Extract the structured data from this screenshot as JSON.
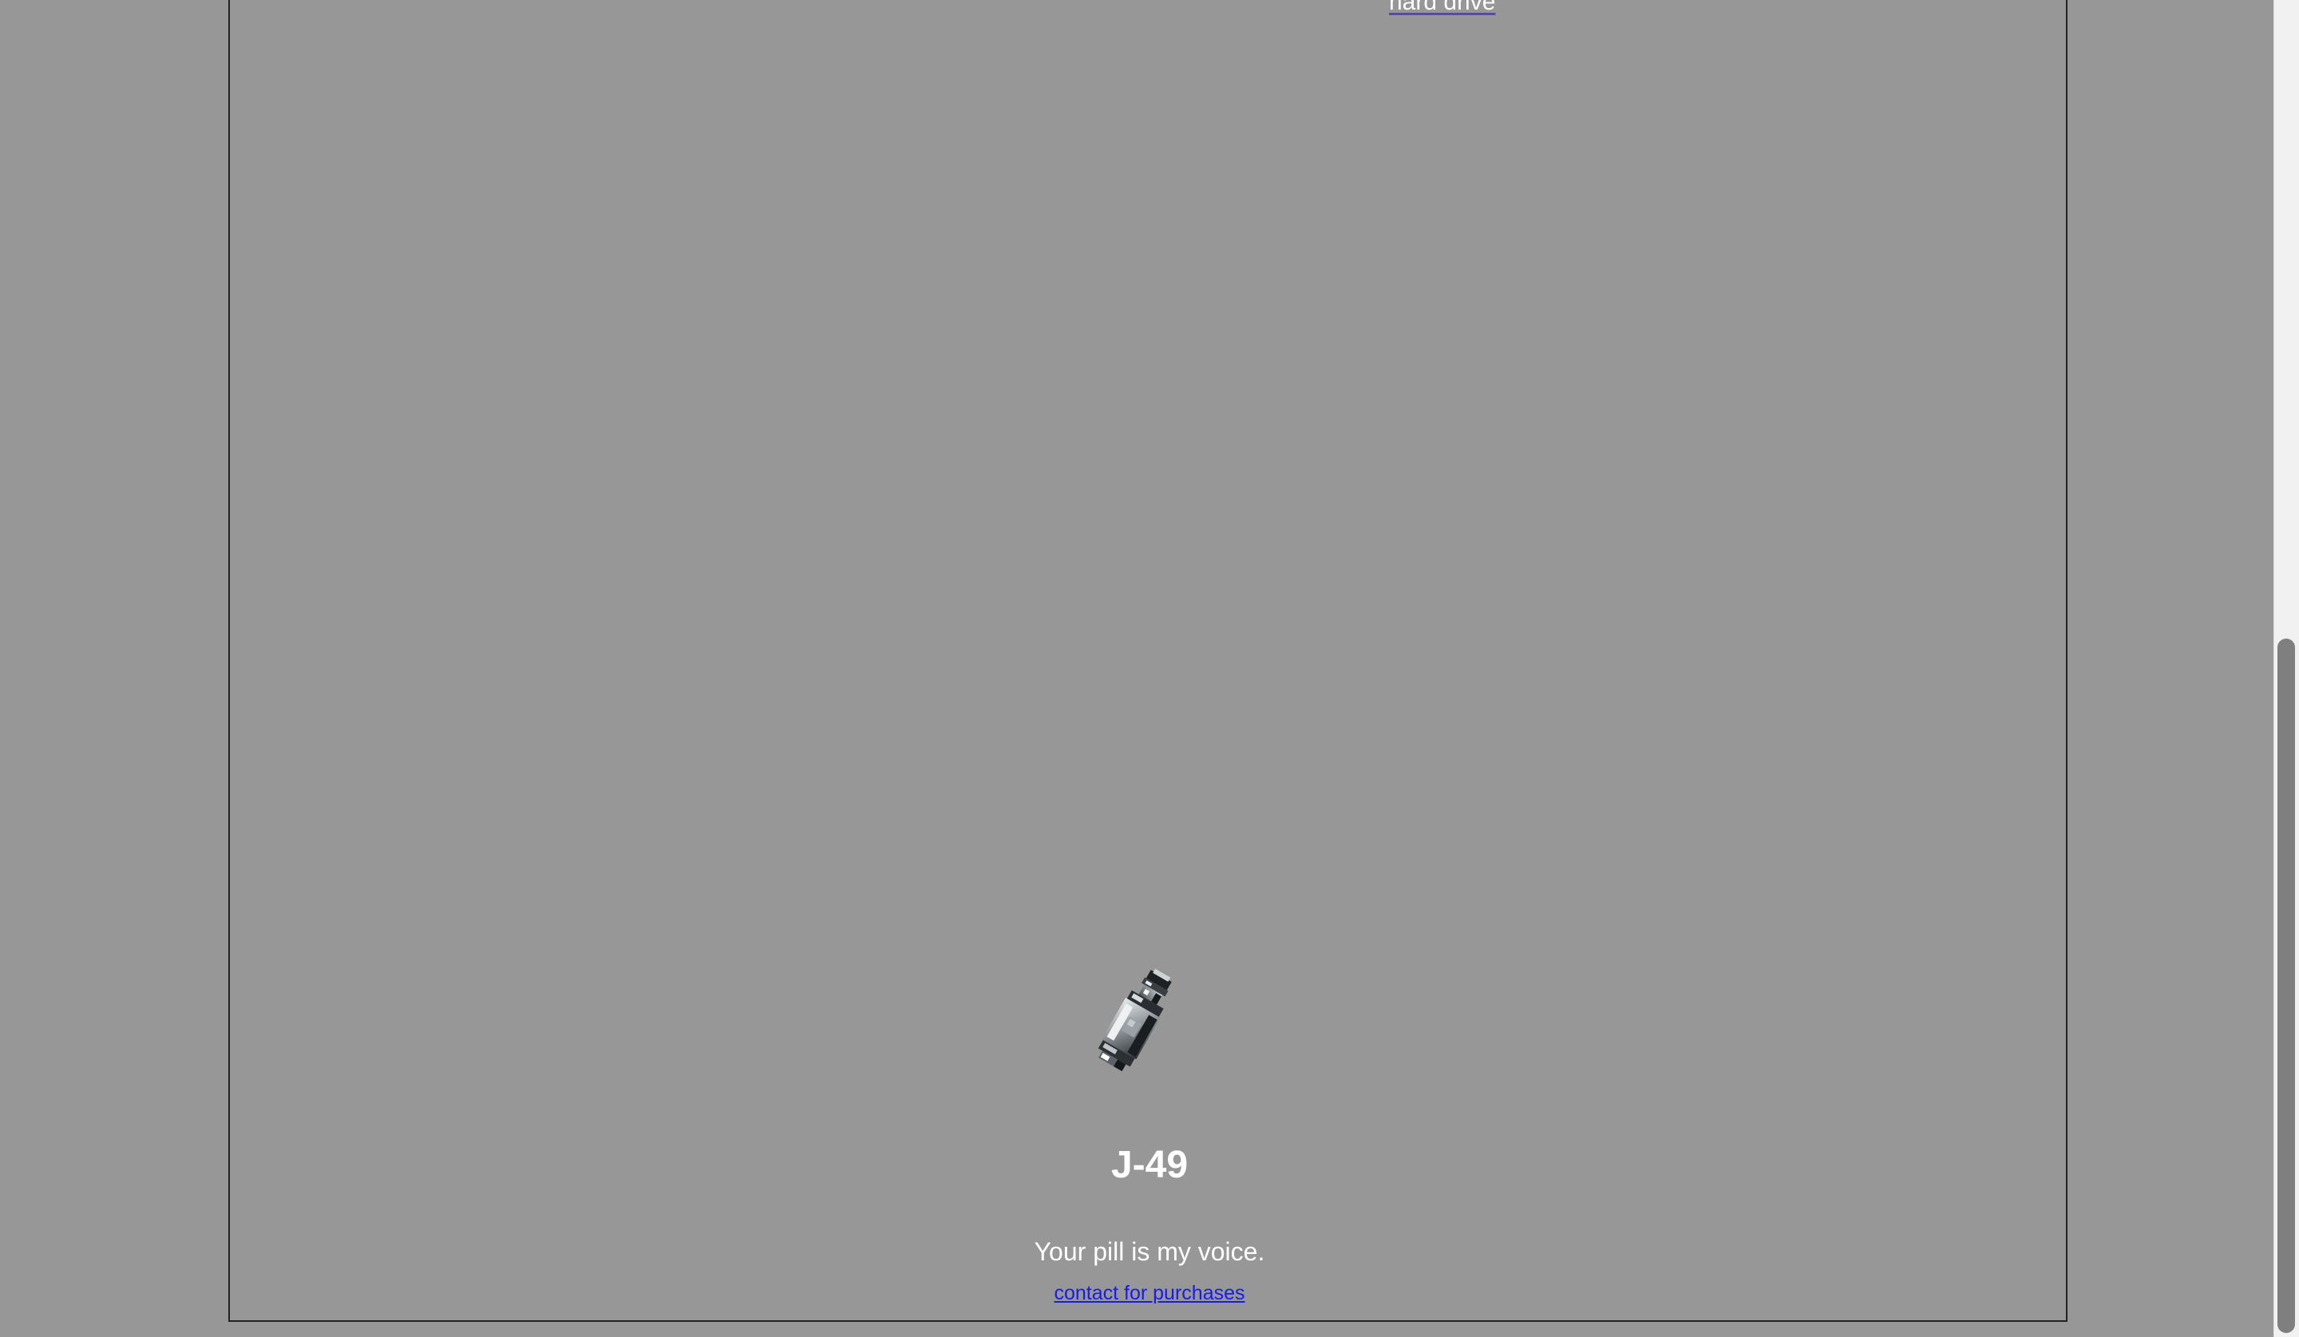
{
  "page": {
    "background_color": "#979797"
  },
  "top_link": {
    "label": "hard drive"
  },
  "product": {
    "image_icon": "pixel-pill-bottle-icon",
    "title": "J-49",
    "tagline": "Your pill is my voice.",
    "contact_label": "contact for purchases",
    "link_color": "#1a1aee"
  },
  "scrollbar": {
    "scroll_position": 0.9
  }
}
